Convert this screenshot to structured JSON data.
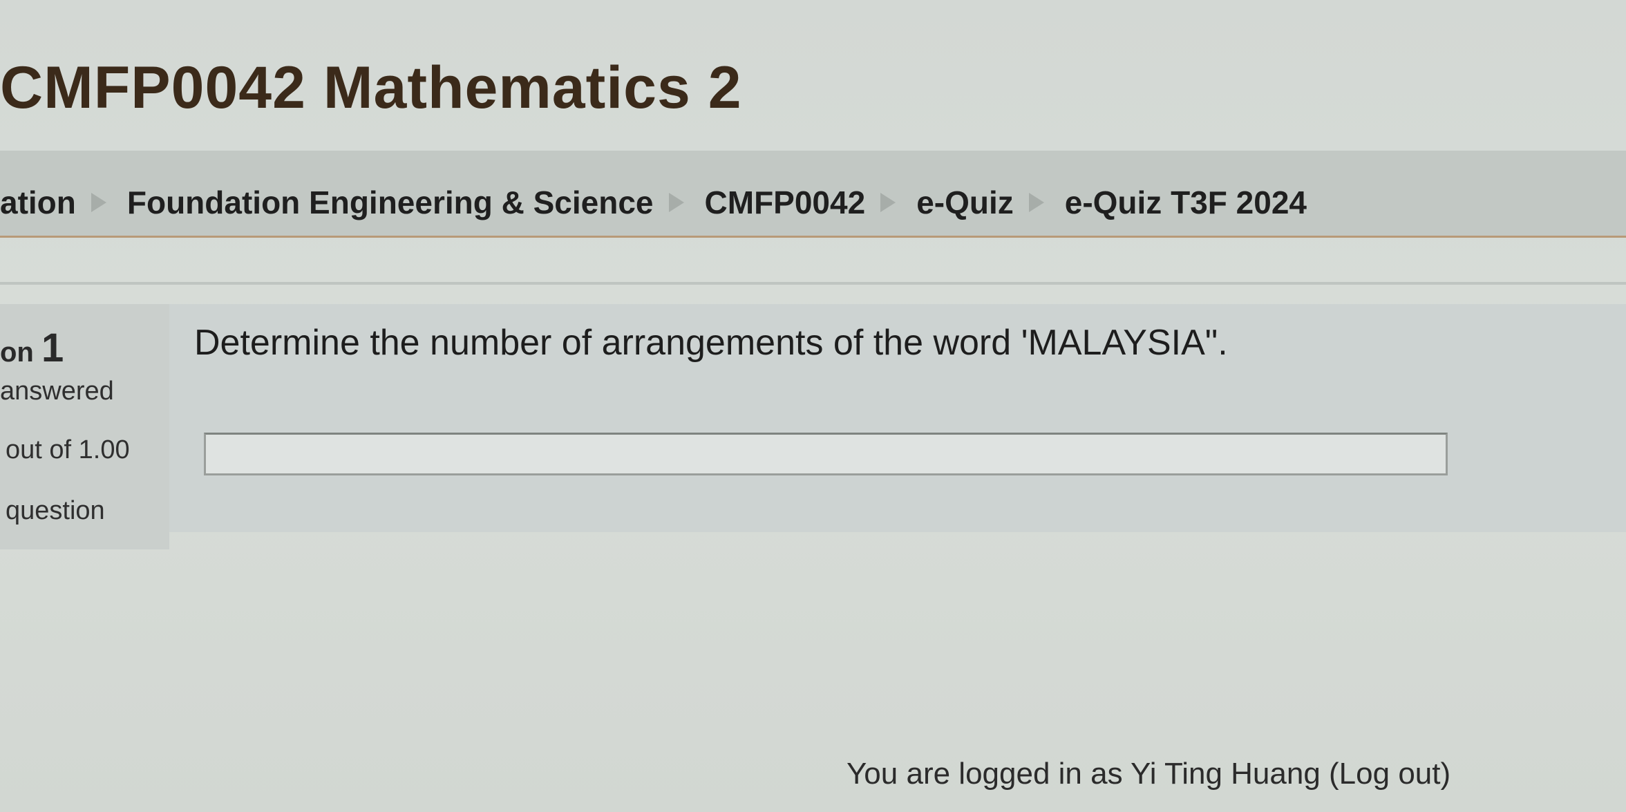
{
  "course": {
    "title": "CMFP0042 Mathematics 2"
  },
  "breadcrumb": {
    "items": [
      "ation",
      "Foundation Engineering & Science",
      "CMFP0042",
      "e-Quiz",
      "e-Quiz T3F 2024"
    ],
    "separator_icon": "triangle-right-icon"
  },
  "question": {
    "number_prefix": "on",
    "number": "1",
    "status": "answered",
    "marks": "out of 1.00",
    "flag_label": "question",
    "text": "Determine the number of arrangements of the word 'MALAYSIA\".",
    "answer_value": ""
  },
  "footer": {
    "logged_in_prefix": "You are logged in as",
    "user_name": "Yi Ting Huang",
    "logout_label": "(Log out)"
  },
  "colors": {
    "title": "#3b2a1a",
    "navbar_bg": "#c2c8c4",
    "navbar_border": "#b89a78",
    "separator": "#a7ada9"
  }
}
